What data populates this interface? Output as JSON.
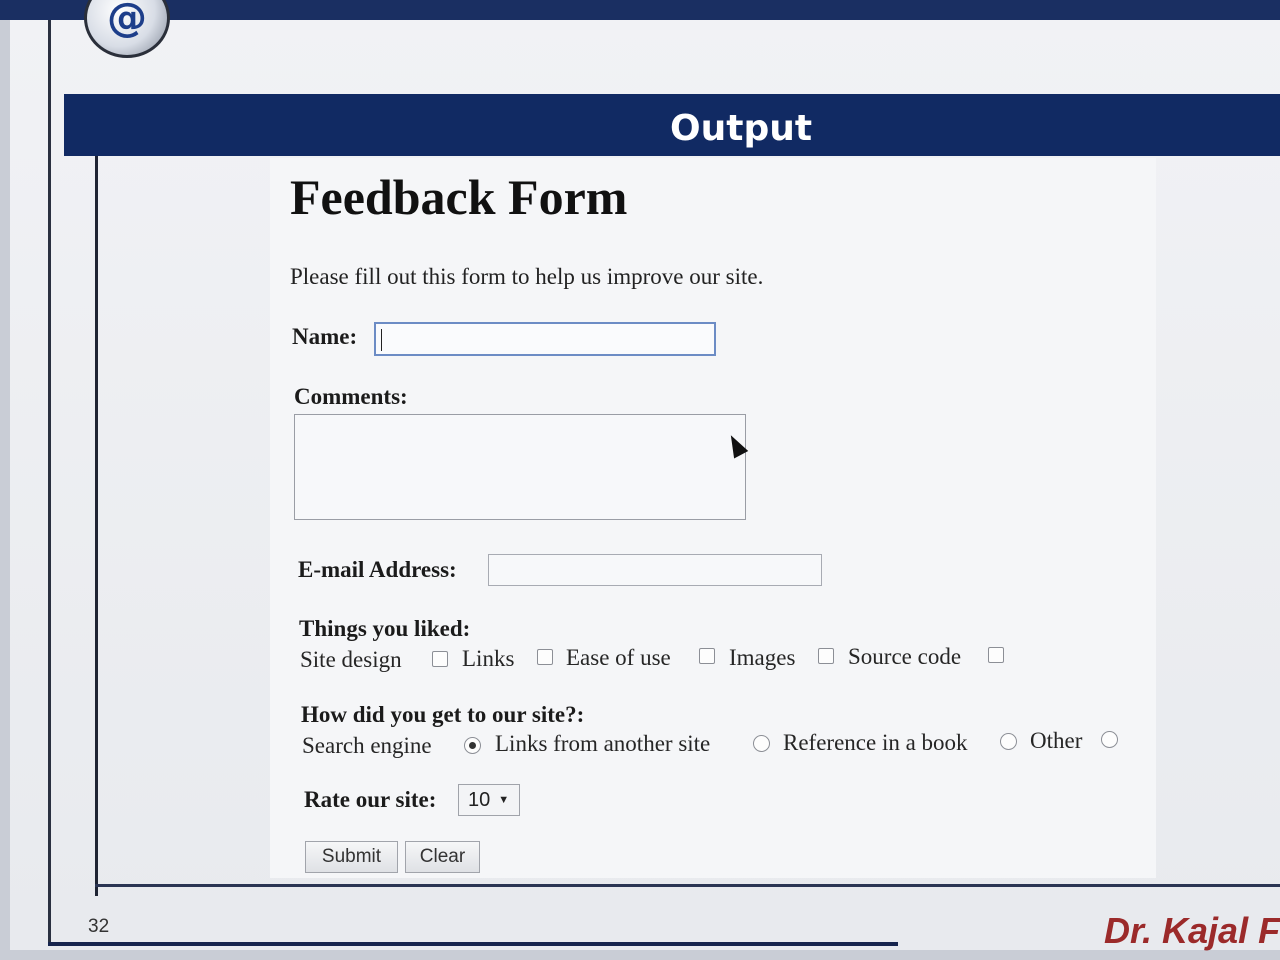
{
  "slide": {
    "header_title": "Output",
    "logo_symbol": "@",
    "page_number": "32",
    "author": "Dr. Kajal F"
  },
  "form": {
    "title": "Feedback Form",
    "intro": "Please fill out this form to help us improve our site.",
    "name_label": "Name:",
    "name_value": "",
    "comments_label": "Comments:",
    "comments_value": "",
    "email_label": "E-mail Address:",
    "email_value": "",
    "liked_label": "Things you liked:",
    "liked_options": [
      {
        "label": "Site design",
        "checked": false
      },
      {
        "label": "Links",
        "checked": false
      },
      {
        "label": "Ease of use",
        "checked": false
      },
      {
        "label": "Images",
        "checked": false
      },
      {
        "label": "Source code",
        "checked": false
      }
    ],
    "source_label": "How did you get to our site?:",
    "source_options": [
      {
        "label": "Search engine",
        "checked": true
      },
      {
        "label": "Links from another site",
        "checked": false
      },
      {
        "label": "Reference in a book",
        "checked": false
      },
      {
        "label": "Other",
        "checked": false
      }
    ],
    "rate_label": "Rate our site:",
    "rate_value": "10",
    "submit_label": "Submit",
    "clear_label": "Clear"
  },
  "colors": {
    "header_band": "#112a63",
    "author_text": "#9b2a2a",
    "name_focus_border": "#6c8cc5"
  },
  "icons": {
    "logo": "at-sign-icon",
    "cursor": "mouse-pointer-icon",
    "select_arrow": "triangle-down-icon"
  }
}
